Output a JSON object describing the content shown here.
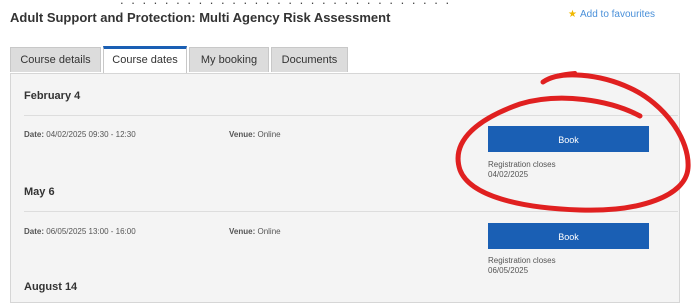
{
  "page": {
    "title": "Adult Support and Protection: Multi Agency Risk Assessment",
    "favourites_label": "Add to favourites"
  },
  "tabs": [
    {
      "label": "Course details"
    },
    {
      "label": "Course dates"
    },
    {
      "label": "My booking"
    },
    {
      "label": "Documents"
    }
  ],
  "labels": {
    "date": "Date:",
    "venue": "Venue:",
    "book": "Book",
    "registration_closes": "Registration closes"
  },
  "sessions": [
    {
      "heading": "February 4",
      "date": "04/02/2025 09:30 - 12:30",
      "venue": "Online",
      "closes": "04/02/2025"
    },
    {
      "heading": "May 6",
      "date": "06/05/2025 13:00 - 16:00",
      "venue": "Online",
      "closes": "06/05/2025"
    },
    {
      "heading": "August 14"
    }
  ],
  "colors": {
    "primary": "#1a5fb4",
    "annotation": "#e02020"
  },
  "icons": {
    "favourite": "star-icon"
  }
}
